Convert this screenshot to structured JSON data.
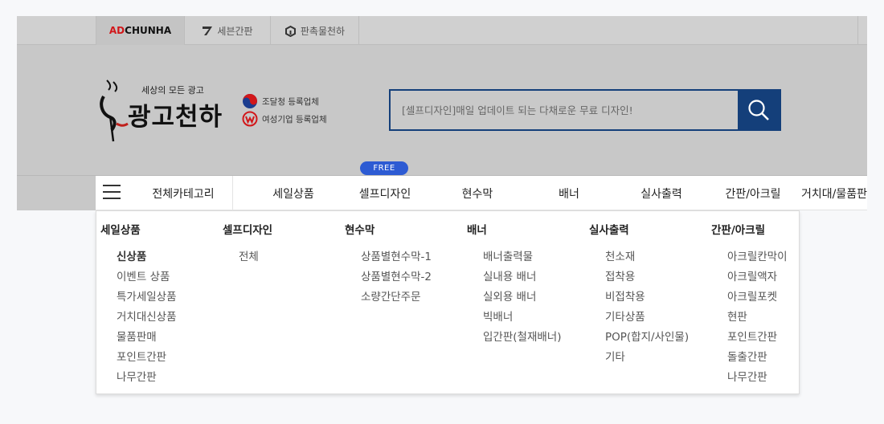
{
  "topbar": {
    "tabs": [
      {
        "label_ad": "AD",
        "label_rest": "CHUNHA"
      },
      {
        "label": "세븐간판"
      },
      {
        "label": "판촉물천하"
      }
    ]
  },
  "header": {
    "logo_tagline": "세상의 모든 광고",
    "logo_title": "광고천하",
    "badges": [
      "조달청 등록업체",
      "여성기업 등록업체"
    ],
    "search_placeholder": "[셀프디자인]매일 업데이트 되는 다채로운 무료 디자인!"
  },
  "nav": {
    "free_badge": "FREE",
    "all_category": "전체카테고리",
    "items": [
      "세일상품",
      "셀프디자인",
      "현수막",
      "배너",
      "실사출력",
      "간판/아크릴",
      "거치대/물품판"
    ]
  },
  "dropdown": {
    "columns": [
      {
        "title": "세일상품",
        "items": [
          "신상품",
          "이벤트 상품",
          "특가세일상품",
          "거치대신상품",
          "물품판매",
          "포인트간판",
          "나무간판"
        ]
      },
      {
        "title": "셀프디자인",
        "items": [
          "전체"
        ]
      },
      {
        "title": "현수막",
        "items": [
          "상품별현수막-1",
          "상품별현수막-2",
          "소량간단주문"
        ]
      },
      {
        "title": "배너",
        "items": [
          "배너출력물",
          "실내용 배너",
          "실외용 배너",
          "빅배너",
          "입간판(철재배너)"
        ]
      },
      {
        "title": "실사출력",
        "items": [
          "천소재",
          "접착용",
          "비접착용",
          "기타상품",
          "POP(합지/사인물)",
          "기타"
        ]
      },
      {
        "title": "간판/아크릴",
        "items": [
          "아크릴칸막이",
          "아크릴액자",
          "아크릴포켓",
          "현판",
          "포인트간판",
          "돌출간판",
          "나무간판"
        ]
      }
    ]
  },
  "colors": {
    "search_border": "#143f7a",
    "free_badge": "#2d5bd3",
    "brand_red": "#d2171a"
  }
}
